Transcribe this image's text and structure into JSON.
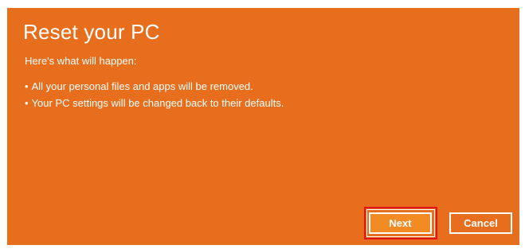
{
  "dialog": {
    "title": "Reset your PC",
    "intro": "Here's what will happen:",
    "bullets": [
      "All your personal files and apps will be removed.",
      "Your PC settings will be changed back to their defaults."
    ],
    "buttons": {
      "next_label": "Next",
      "cancel_label": "Cancel"
    }
  },
  "colors": {
    "background": "#e76e1c",
    "next_button": "#f38b25",
    "highlight": "#e0141b",
    "text": "#ffffff"
  }
}
